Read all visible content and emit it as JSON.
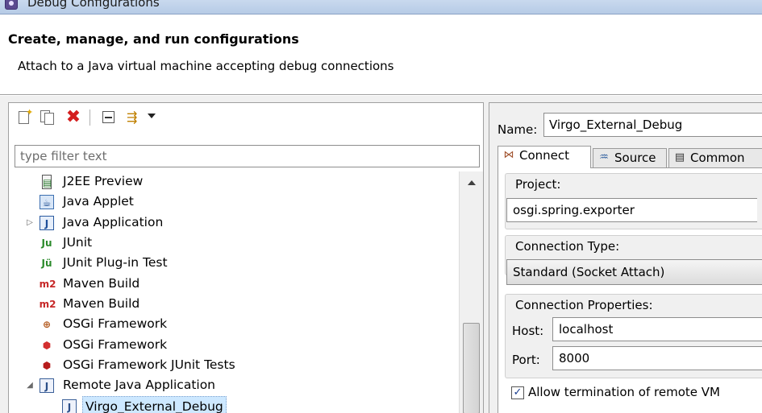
{
  "window": {
    "title": "Debug Configurations"
  },
  "header": {
    "title": "Create, manage, and run configurations",
    "subtitle": "Attach to a Java virtual machine accepting debug connections"
  },
  "toolbar": {
    "buttons": [
      {
        "name": "new-launch-configuration",
        "icon": "new-config-icon"
      },
      {
        "name": "duplicate",
        "icon": "duplicate-icon"
      },
      {
        "name": "delete",
        "icon": "delete-icon"
      },
      {
        "name": "collapse-all",
        "icon": "collapse-all-icon"
      },
      {
        "name": "filter",
        "icon": "filter-icon"
      },
      {
        "name": "view-menu",
        "icon": "chevron-down-icon"
      }
    ]
  },
  "filter": {
    "placeholder": "type filter text"
  },
  "tree": {
    "items": [
      {
        "label": "J2EE Preview",
        "icon": "j2ee-preview-icon"
      },
      {
        "label": "Java Applet",
        "icon": "java-applet-icon"
      },
      {
        "label": "Java Application",
        "icon": "java-application-icon",
        "expander": "collapsed"
      },
      {
        "label": "JUnit",
        "icon": "junit-icon"
      },
      {
        "label": "JUnit Plug-in Test",
        "icon": "junit-plugin-icon"
      },
      {
        "label": "Maven Build",
        "icon": "maven-icon"
      },
      {
        "label": "Maven Build",
        "icon": "maven-icon"
      },
      {
        "label": "OSGi Framework",
        "icon": "osgi-framework-icon"
      },
      {
        "label": "OSGi Framework",
        "icon": "osgi-framework-icon"
      },
      {
        "label": "OSGi Framework JUnit Tests",
        "icon": "osgi-junit-icon"
      },
      {
        "label": "Remote Java Application",
        "icon": "remote-java-icon",
        "expander": "expanded"
      },
      {
        "label": "Virgo_External_Debug",
        "icon": "remote-java-config-icon",
        "selected": true
      }
    ]
  },
  "config": {
    "name_label": "Name:",
    "name_value": "Virgo_External_Debug",
    "tabs": [
      {
        "label": "Connect",
        "icon": "connect-icon",
        "active": true
      },
      {
        "label": "Source",
        "icon": "source-icon",
        "active": false
      },
      {
        "label": "Common",
        "icon": "common-icon",
        "active": false
      }
    ],
    "project_label": "Project:",
    "project_value": "osgi.spring.exporter",
    "connection_type_label": "Connection Type:",
    "connection_type_value": "Standard (Socket Attach)",
    "connection_props_label": "Connection Properties:",
    "host_label": "Host:",
    "host_value": "localhost",
    "port_label": "Port:",
    "port_value": "8000",
    "allow_termination_label": "Allow termination of remote VM",
    "allow_termination_checked": true
  }
}
